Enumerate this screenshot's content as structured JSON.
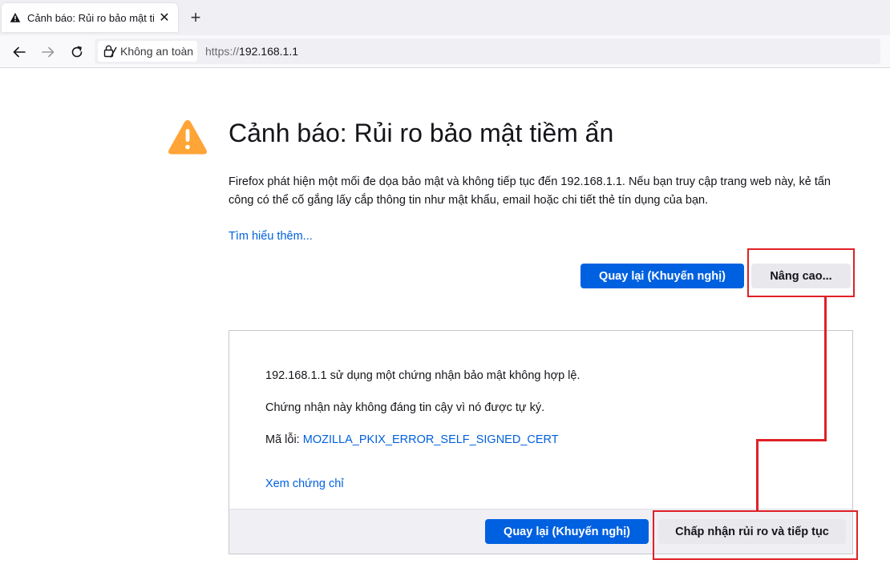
{
  "browser": {
    "tab": {
      "title": "Cảnh báo: Rủi ro bảo mật tiềm ẩn",
      "close_glyph": "✕"
    },
    "new_tab_glyph": "+",
    "identity": {
      "label": "Không an toàn"
    },
    "url": {
      "scheme": "https://",
      "host": "192.168.1.1"
    }
  },
  "page": {
    "title": "Cảnh báo: Rủi ro bảo mật tiềm ẩn",
    "description": "Firefox phát hiện một mối đe dọa bảo mật và không tiếp tục đến 192.168.1.1. Nếu bạn truy cập trang web này, kẻ tấn công có thể cố gắng lấy cắp thông tin như mật khẩu, email hoặc chi tiết thẻ tín dụng của bạn.",
    "learn_more": "Tìm hiểu thêm...",
    "go_back_label": "Quay lại (Khuyến nghị)",
    "advanced_label": "Nâng cao..."
  },
  "advanced_panel": {
    "line1": "192.168.1.1 sử dụng một chứng nhận bảo mật không hợp lệ.",
    "line2": "Chứng nhận này không đáng tin cậy vì nó được tự ký.",
    "error_prefix": "Mã lỗi: ",
    "error_code": "MOZILLA_PKIX_ERROR_SELF_SIGNED_CERT",
    "view_cert": "Xem chứng chỉ",
    "go_back_label": "Quay lại (Khuyến nghị)",
    "accept_label": "Chấp nhận rủi ro và tiếp tục"
  },
  "colors": {
    "primary_button": "#0061e0",
    "link": "#0060df",
    "warning_icon": "#ffa436",
    "annotation": "#e02027"
  },
  "icons": {
    "tab": "warning-icon",
    "back": "back-arrow-icon",
    "forward": "forward-arrow-icon",
    "reload": "reload-icon",
    "identity": "insecure-lock-icon",
    "page_warning": "warning-triangle-icon"
  }
}
